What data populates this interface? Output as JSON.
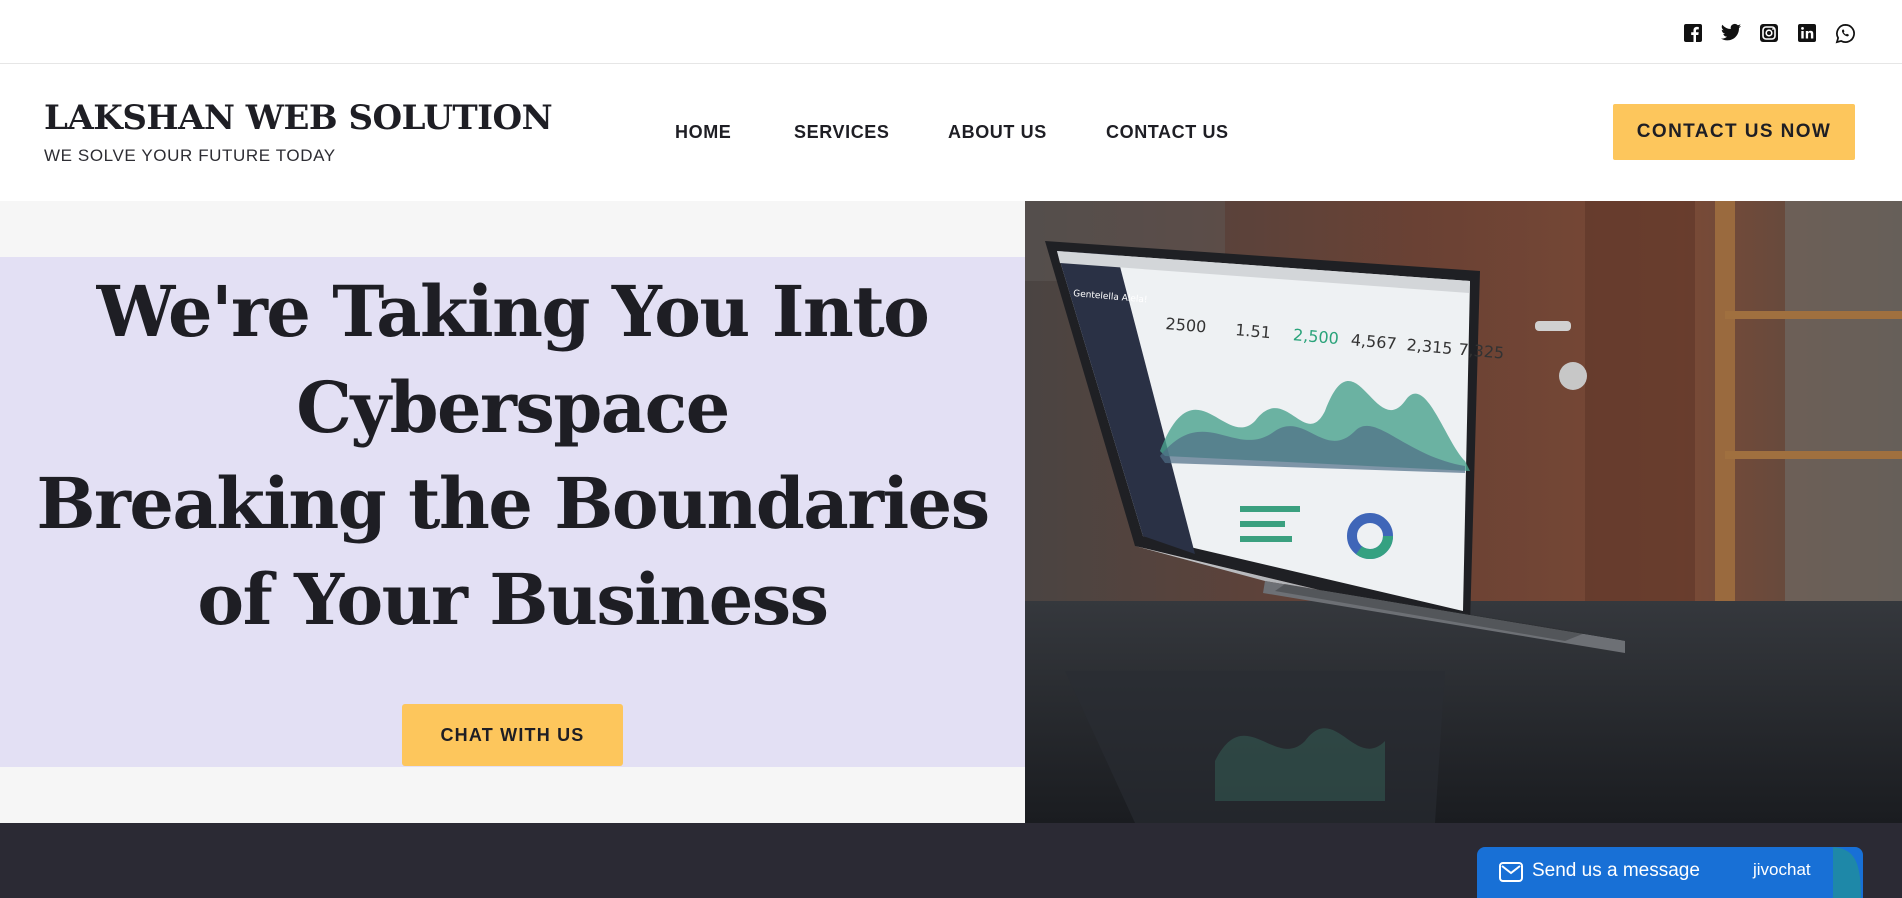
{
  "social": {
    "icons": [
      "facebook-icon",
      "twitter-icon",
      "instagram-icon",
      "linkedin-icon",
      "whatsapp-icon"
    ]
  },
  "brand": {
    "name": "LAKSHAN WEB SOLUTION",
    "tagline": "WE SOLVE YOUR FUTURE TODAY"
  },
  "nav": {
    "items": [
      {
        "label": "HOME"
      },
      {
        "label": "SERVICES"
      },
      {
        "label": "ABOUT US"
      },
      {
        "label": "CONTACT US"
      }
    ],
    "cta_label": "CONTACT US NOW"
  },
  "hero": {
    "title_lines": [
      "We're Taking You Into",
      "Cyberspace",
      "Breaking the Boundaries",
      "of Your Business"
    ],
    "button_label": "CHAT WITH US",
    "image_subject": "laptop showing analytics dashboard on glossy desk"
  },
  "dashboard": {
    "brand": "Gentelella Alela!",
    "stats": [
      "2500",
      "1.51",
      "2,500",
      "4,567",
      "2,315",
      "7,325"
    ]
  },
  "chat_widget": {
    "label": "Send us a message",
    "brand": "jivochat"
  },
  "colors": {
    "accent": "#fdc65c",
    "hero_panel": "#e3e0f4",
    "text_dark": "#1e1e24",
    "footer": "#2b2a34",
    "chat_blue": "#1870d6"
  }
}
